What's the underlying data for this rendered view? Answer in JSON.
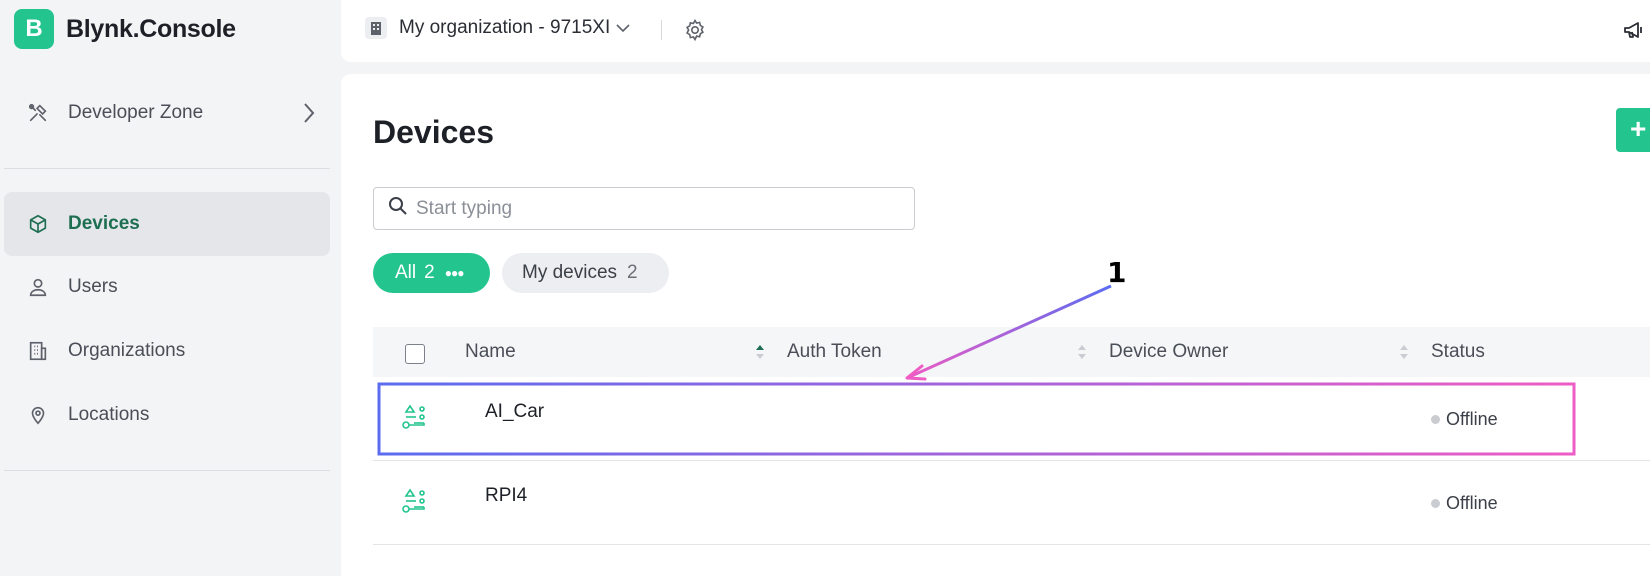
{
  "brand": {
    "logo_letter": "B",
    "name": "Blynk.Console",
    "accent": "#23c48e"
  },
  "sidebar": {
    "developer_zone": {
      "label": "Developer Zone",
      "icon": "tools-icon"
    },
    "items": [
      {
        "label": "Devices",
        "icon": "cube-icon",
        "active": true
      },
      {
        "label": "Users",
        "icon": "users-icon",
        "active": false
      },
      {
        "label": "Organizations",
        "icon": "building-icon",
        "active": false
      },
      {
        "label": "Locations",
        "icon": "location-pin-icon",
        "active": false
      }
    ]
  },
  "topbar": {
    "organization": "My organization - 9715XI",
    "icons": [
      "building-icon",
      "chevron-down-icon",
      "gear-icon",
      "megaphone-icon"
    ]
  },
  "main": {
    "title": "Devices",
    "add_button_label": "+",
    "search": {
      "placeholder": "Start typing",
      "value": ""
    },
    "filters": [
      {
        "label": "All",
        "count": "2",
        "active": true
      },
      {
        "label": "My devices",
        "count": "2",
        "active": false
      }
    ],
    "table": {
      "columns": [
        "Name",
        "Auth Token",
        "Device Owner",
        "Status"
      ],
      "rows": [
        {
          "name": "AI_Car",
          "auth_token": "",
          "owner": "",
          "status": "Offline"
        },
        {
          "name": "RPI4",
          "auth_token": "",
          "owner": "",
          "status": "Offline"
        }
      ]
    }
  },
  "annotation": {
    "label": "1",
    "gradient_start": "#5b6cf0",
    "gradient_end": "#ee5cc4"
  }
}
